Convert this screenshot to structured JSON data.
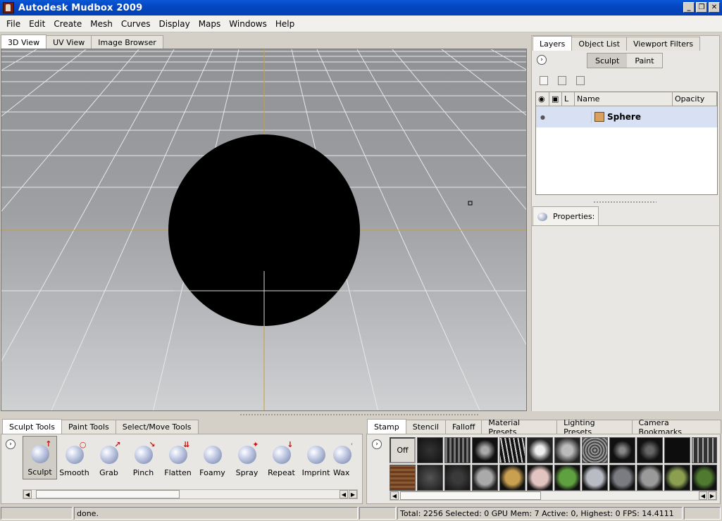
{
  "window": {
    "title": "Autodesk Mudbox 2009",
    "buttons": [
      "_",
      "❐",
      "✕"
    ]
  },
  "menus": [
    "File",
    "Edit",
    "Create",
    "Mesh",
    "Curves",
    "Display",
    "Maps",
    "Windows",
    "Help"
  ],
  "view_tabs": [
    "3D View",
    "UV View",
    "Image Browser"
  ],
  "right_tabs": [
    "Layers",
    "Object List",
    "Viewport Filters"
  ],
  "layer_mode": {
    "sculpt": "Sculpt",
    "paint": "Paint"
  },
  "layer_table": {
    "columns": {
      "visible": "",
      "lock": "",
      "l": "L",
      "name": "Name",
      "opacity": "Opacity"
    },
    "rows": [
      {
        "name": "Sphere"
      }
    ]
  },
  "properties_label": "Properties:",
  "bottom_left_tabs": [
    "Sculpt Tools",
    "Paint Tools",
    "Select/Move Tools"
  ],
  "sculpt_tools": [
    "Sculpt",
    "Smooth",
    "Grab",
    "Pinch",
    "Flatten",
    "Foamy",
    "Spray",
    "Repeat",
    "Imprint",
    "Wax"
  ],
  "bottom_right_tabs": [
    "Stamp",
    "Stencil",
    "Falloff",
    "Material Presets",
    "Lighting Presets",
    "Camera Bookmarks"
  ],
  "stamp_off_label": "Off",
  "status": {
    "message": "done.",
    "stats": "Total: 2256  Selected: 0 GPU Mem: 7  Active: 0, Highest: 0  FPS: 14.4111"
  },
  "colors": {
    "titlebar": "#0447c3",
    "axis": "#c8a040",
    "selection": "#d8e0f4"
  }
}
